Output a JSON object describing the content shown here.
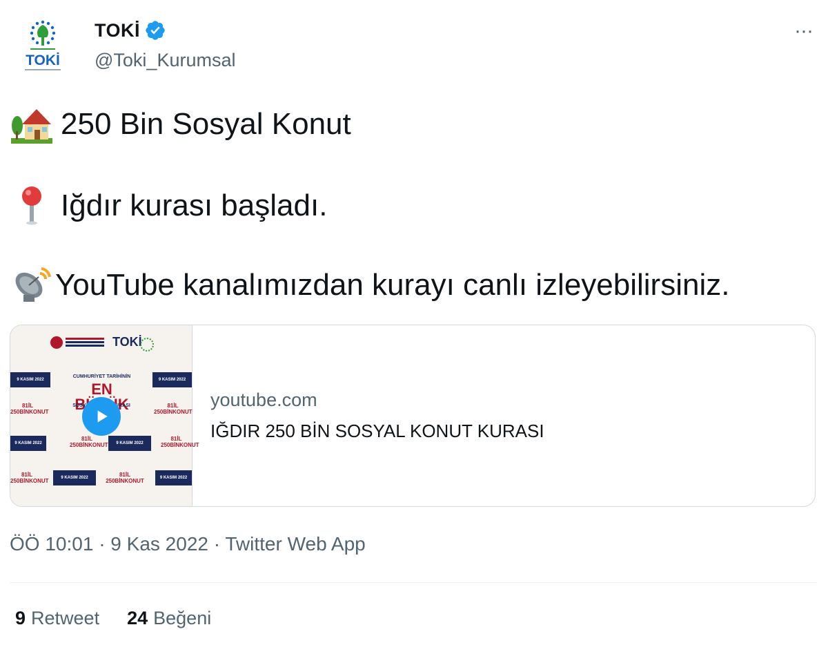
{
  "author": {
    "display_name": "TOKİ",
    "handle": "@Toki_Kurumsal",
    "avatar_text": "TOKİ",
    "verified_icon": "verified-badge-icon"
  },
  "more_menu": "···",
  "tweet": {
    "line1": {
      "emoji_icon": "house-with-garden-icon",
      "text": "250 Bin Sosyal Konut"
    },
    "line2": {
      "emoji_icon": "round-pushpin-icon",
      "text": "Iğdır kurası başladı."
    },
    "line3": {
      "emoji_icon": "satellite-antenna-icon",
      "text": "YouTube kanalımızdan kurayı canlı izleyebilirsiniz."
    }
  },
  "link_card": {
    "domain": "youtube.com",
    "title": "IĞDIR 250 BİN SOSYAL KONUT KURASI",
    "thumbnail": {
      "logo_text": "TOKİ",
      "headline_small": "CUMHURİYET TARİHİNİN",
      "headline_big": "EN BÜYÜK",
      "headline_rest": "SOSYAL KONUT KURASI",
      "badge_date": "9 KASIM 2022",
      "badge_label": "81İL 250BİNKONUT"
    }
  },
  "meta": {
    "time": "ÖÖ 10:01",
    "date": "9 Kas 2022",
    "source": "Twitter Web App",
    "separator": "·"
  },
  "stats": {
    "retweets": "9",
    "retweets_label": "Retweet",
    "likes": "24",
    "likes_label": "Beğeni"
  },
  "colors": {
    "accent": "#1d9bf0",
    "text_primary": "#0f1419",
    "text_secondary": "#536471",
    "border": "#cfd9de"
  }
}
